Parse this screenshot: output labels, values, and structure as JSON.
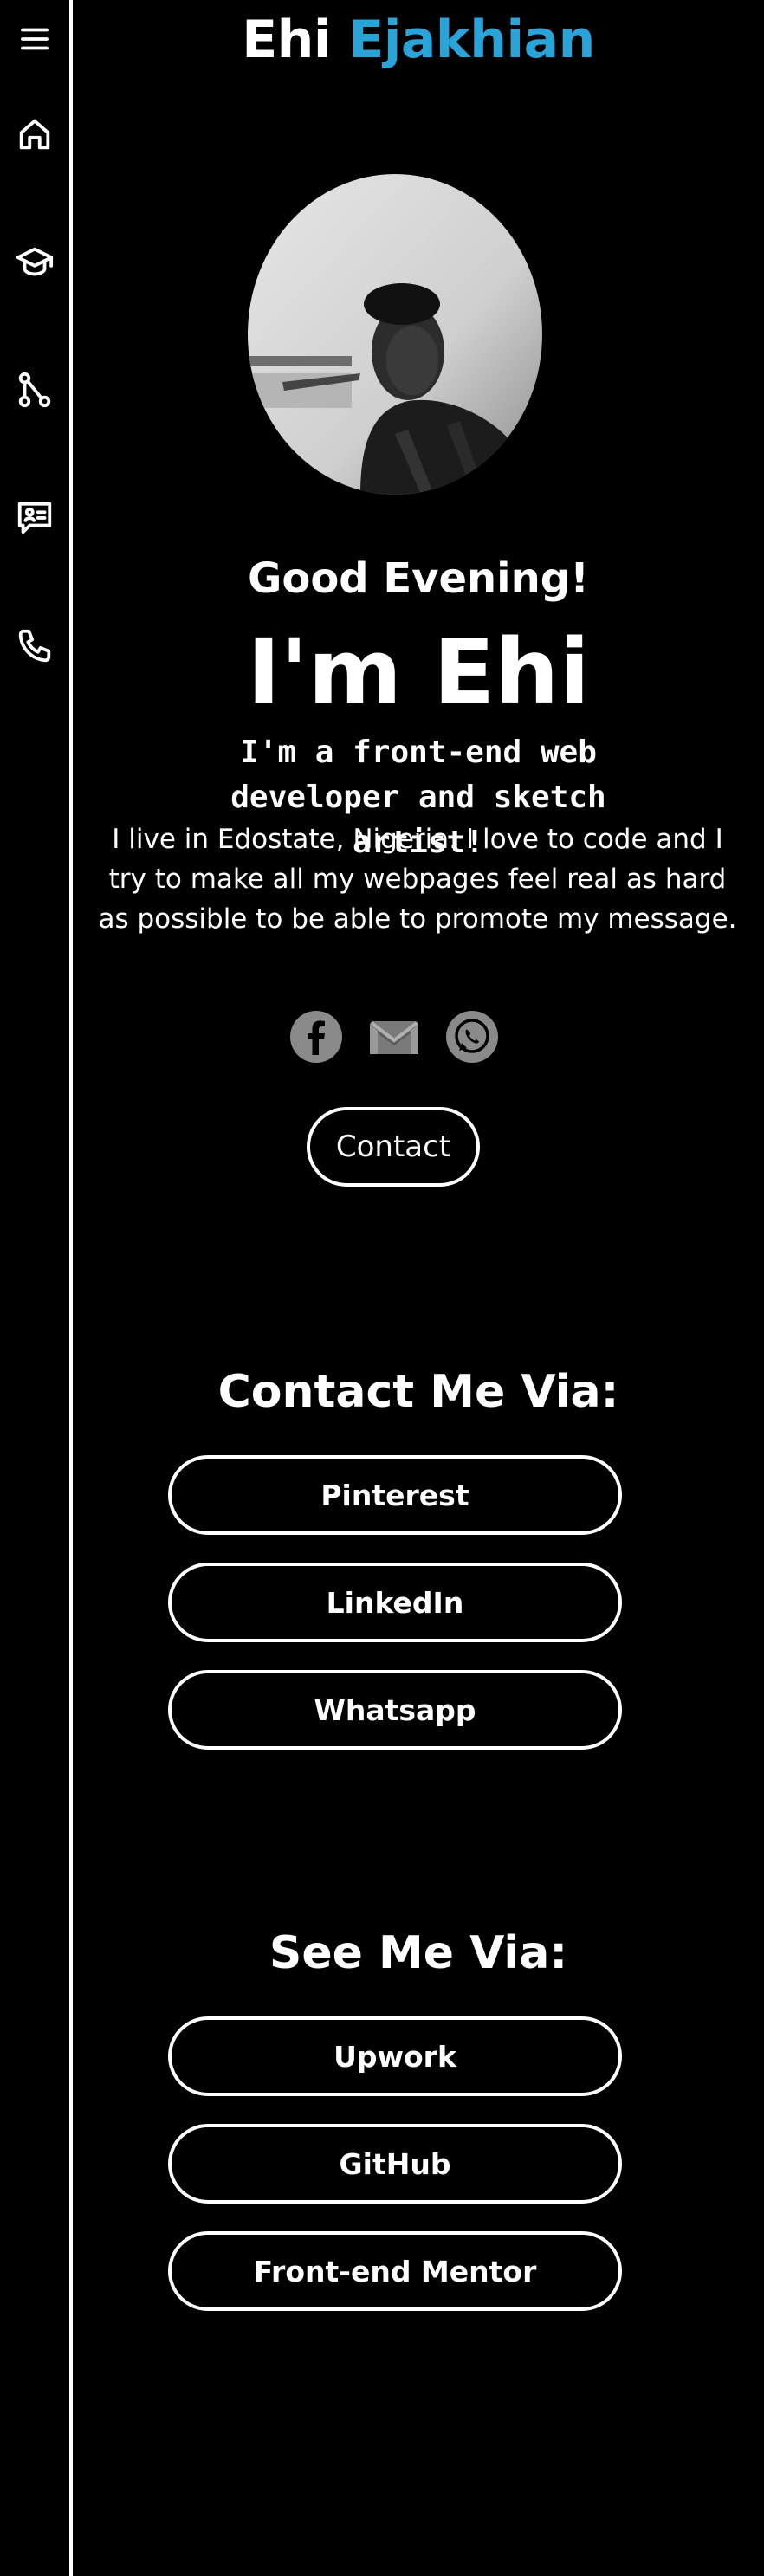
{
  "sidebar": {
    "items": [
      {
        "icon": "menu-icon"
      },
      {
        "icon": "home-icon"
      },
      {
        "icon": "graduation-cap-icon"
      },
      {
        "icon": "git-branch-icon"
      },
      {
        "icon": "message-person-icon"
      },
      {
        "icon": "phone-icon"
      }
    ]
  },
  "brand": {
    "first": "Ehi",
    "last": "Ejakhian",
    "accent_color": "#2aa3d8"
  },
  "hero": {
    "greeting": "Good Evening!",
    "name": "I'm Ehi",
    "tagline": "I'm a front-end web developer and sketch artist!",
    "bio": "I live in Edostate, Nigeria. I love to code and I try to make all my webpages feel real as hard as possible to be able to promote my message.",
    "socials": [
      {
        "icon": "facebook-icon"
      },
      {
        "icon": "gmail-icon"
      },
      {
        "icon": "whatsapp-icon"
      }
    ],
    "contact_label": "Contact"
  },
  "contact_section": {
    "title": "Contact Me Via:",
    "links": [
      "Pinterest",
      "LinkedIn",
      "Whatsapp"
    ]
  },
  "see_section": {
    "title": "See Me Via:",
    "links": [
      "Upwork",
      "GitHub",
      "Front-end Mentor"
    ]
  },
  "colors": {
    "background": "#000000",
    "foreground": "#ffffff",
    "social_icon_fill": "#8a8a8a"
  }
}
